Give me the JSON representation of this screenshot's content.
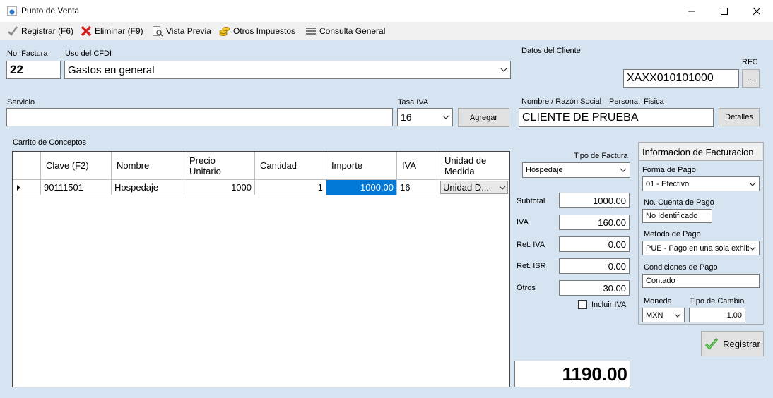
{
  "window": {
    "title": "Punto de Venta"
  },
  "toolbar": {
    "registrar": "Registrar (F6)",
    "eliminar": "Eliminar (F9)",
    "vista_previa": "Vista Previa",
    "otros_impuestos": "Otros Impuestos",
    "consulta_general": "Consulta General"
  },
  "form": {
    "no_factura_label": "No. Factura",
    "no_factura_value": "22",
    "uso_cfdi_label": "Uso del CFDI",
    "uso_cfdi_value": "Gastos en general",
    "servicio_label": "Servicio",
    "servicio_value": "",
    "tasa_iva_label": "Tasa IVA",
    "tasa_iva_value": "16",
    "agregar_label": "Agregar"
  },
  "cliente": {
    "section_label": "Datos del Cliente",
    "rfc_label": "RFC",
    "rfc_value": "XAXX010101000",
    "rfc_browse": "...",
    "nombre_label": "Nombre / Razón Social",
    "persona_label": "Persona:",
    "persona_value": "Fisica",
    "nombre_value": "CLIENTE DE PRUEBA",
    "detalles_label": "Detalles"
  },
  "carrito": {
    "label": "Carrito de Conceptos",
    "columns": {
      "clave": "Clave (F2)",
      "nombre": "Nombre",
      "precio_1": "Precio",
      "precio_2": "Unitario",
      "cantidad": "Cantidad",
      "importe": "Importe",
      "iva": "IVA",
      "unidad_1": "Unidad de",
      "unidad_2": "Medida"
    },
    "rows": [
      {
        "clave": "90111501",
        "nombre": "Hospedaje",
        "precio": "1000",
        "cantidad": "1",
        "importe": "1000.00",
        "iva": "16",
        "unidad": "Unidad D..."
      }
    ]
  },
  "totales": {
    "tipo_factura_label": "Tipo de Factura",
    "tipo_factura_value": "Hospedaje",
    "subtotal_label": "Subtotal",
    "subtotal_value": "1000.00",
    "iva_label": "IVA",
    "iva_value": "160.00",
    "ret_iva_label": "Ret. IVA",
    "ret_iva_value": "0.00",
    "ret_isr_label": "Ret. ISR",
    "ret_isr_value": "0.00",
    "otros_label": "Otros",
    "otros_value": "30.00",
    "incluir_iva_label": "Incluir IVA",
    "total_value": "1190.00"
  },
  "facturacion": {
    "title": "Informacion de Facturacion",
    "forma_pago_label": "Forma de Pago",
    "forma_pago_value": "01 - Efectivo",
    "cuenta_label": "No. Cuenta de Pago",
    "cuenta_value": "No Identificado",
    "metodo_label": "Metodo de Pago",
    "metodo_value": "PUE - Pago en una sola exhib",
    "condiciones_label": "Condiciones de Pago",
    "condiciones_value": "Contado",
    "moneda_label": "Moneda",
    "moneda_value": "MXN",
    "tipo_cambio_label": "Tipo de Cambio",
    "tipo_cambio_value": "1.00",
    "registrar_label": "Registrar"
  },
  "colors": {
    "form_bg": "#d6e3f0",
    "selection": "#0078d7"
  }
}
